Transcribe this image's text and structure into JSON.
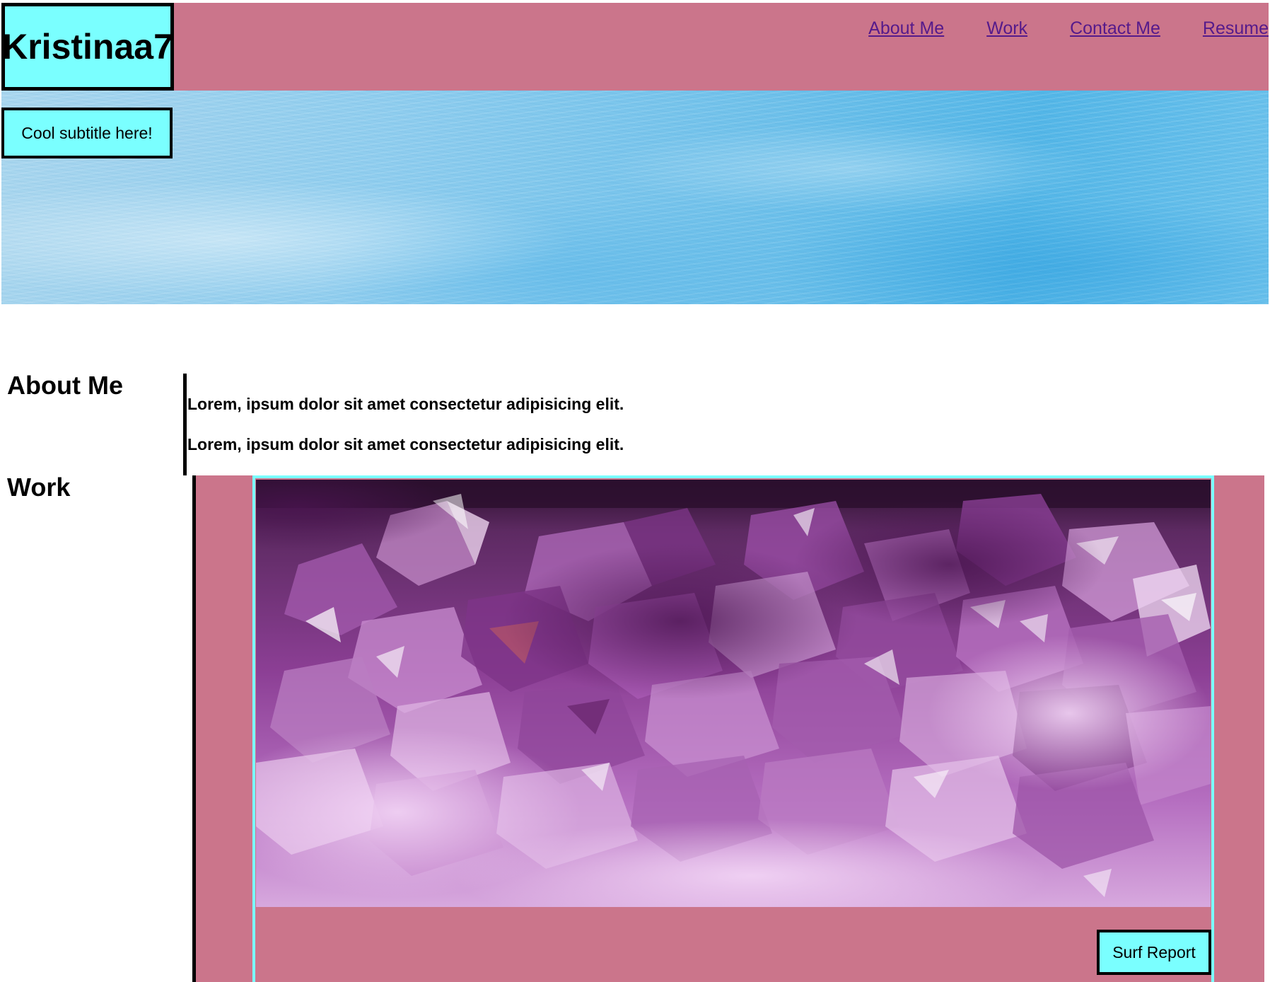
{
  "header": {
    "logo": "Kristinaa7",
    "nav": [
      {
        "label": "About Me"
      },
      {
        "label": "Work"
      },
      {
        "label": "Contact Me"
      },
      {
        "label": "Resume"
      }
    ]
  },
  "hero": {
    "subtitle": "Cool subtitle here!"
  },
  "about": {
    "heading": "About Me",
    "paragraphs": [
      "Lorem, ipsum dolor sit amet consectetur adipisicing elit.",
      "Lorem, ipsum dolor sit amet consectetur adipisicing elit."
    ]
  },
  "work": {
    "heading": "Work",
    "card_button": "Surf Report"
  },
  "colors": {
    "header_bg": "#cb758b",
    "accent_cyan": "#7affff",
    "link": "#551a8b",
    "border": "#000000"
  }
}
